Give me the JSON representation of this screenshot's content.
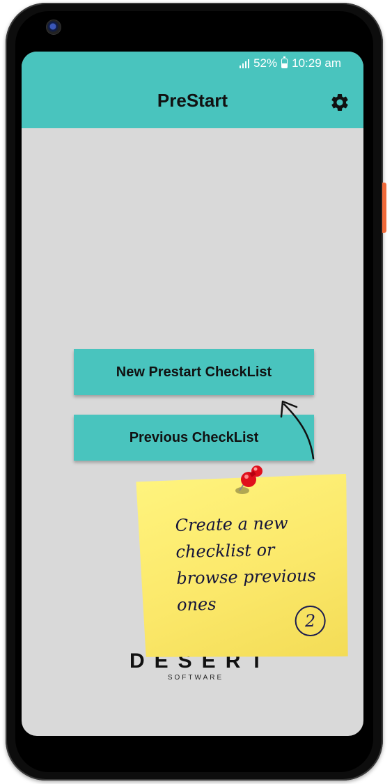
{
  "status_bar": {
    "battery": "52%",
    "time": "10:29 am"
  },
  "app_bar": {
    "title": "PreStart"
  },
  "buttons": {
    "new_checklist": "New Prestart CheckList",
    "previous_checklist": "Previous CheckList"
  },
  "logo": {
    "name": "DESERT",
    "subtitle": "SOFTWARE"
  },
  "sticky_note": {
    "line1": "Create a new",
    "line2": "checklist or",
    "line3": "browse previous",
    "line4": "ones",
    "step": "2"
  },
  "colors": {
    "accent": "#49c4be",
    "screen_background": "#d9d9d9",
    "sticky_note": "#fbe86a",
    "side_button": "#ef6a3a"
  },
  "icons": {
    "settings": "gear-icon",
    "signal": "signal-icon",
    "battery": "battery-icon",
    "pin": "pushpin-icon",
    "arrow": "arrow-icon"
  }
}
